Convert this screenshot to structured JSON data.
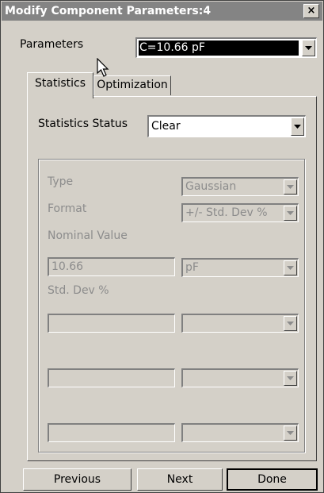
{
  "window": {
    "title": "Modify Component Parameters:4",
    "close_glyph": "×"
  },
  "parameters": {
    "label": "Parameters",
    "value": "C=10.66 pF"
  },
  "tabs": [
    {
      "label": "Statistics",
      "active": true
    },
    {
      "label": "Optimization",
      "active": false
    }
  ],
  "statistics": {
    "status_label": "Statistics Status",
    "status_value": "Clear",
    "type_label": "Type",
    "type_value": "Gaussian",
    "format_label": "Format",
    "format_value": "+/- Std. Dev %",
    "nominal_label": "Nominal Value",
    "nominal_value": "10.66",
    "nominal_unit": "pF",
    "stddev_label": "Std. Dev %"
  },
  "buttons": {
    "previous": "Previous",
    "next": "Next",
    "done": "Done"
  }
}
